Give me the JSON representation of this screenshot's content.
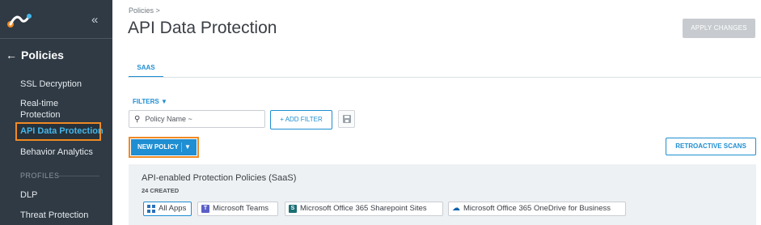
{
  "sidebar": {
    "collapse_glyph": "«",
    "back_label": "Policies",
    "items": [
      {
        "label": "SSL Decryption"
      },
      {
        "label": "Real-time\nProtection"
      },
      {
        "label": "API Data Protection"
      },
      {
        "label": "Behavior Analytics"
      }
    ],
    "section_label": "PROFILES",
    "section_items": [
      {
        "label": "DLP"
      },
      {
        "label": "Threat Protection"
      }
    ]
  },
  "header": {
    "breadcrumb": "Policies >",
    "title": "API Data Protection",
    "apply_label": "APPLY CHANGES"
  },
  "tabs": [
    {
      "label": "SAAS",
      "active": true
    }
  ],
  "filters": {
    "label": "FILTERS",
    "search_value": "Policy Name ~",
    "add_filter_label": "+ ADD FILTER"
  },
  "actions": {
    "new_policy_label": "NEW POLICY",
    "retroactive_label": "RETROACTIVE SCANS"
  },
  "policy_group": {
    "title": "API-enabled Protection Policies (SaaS)",
    "count": "24 CREATED",
    "apps": [
      {
        "label": "All Apps",
        "icon": "grid-icon",
        "selected": true
      },
      {
        "label": "Microsoft Teams",
        "icon": "teams-icon",
        "selected": false
      },
      {
        "label": "Microsoft Office 365 Sharepoint Sites",
        "icon": "sharepoint-icon",
        "selected": false
      },
      {
        "label": "Microsoft Office 365 OneDrive for Business",
        "icon": "onedrive-icon",
        "selected": false
      }
    ]
  },
  "colors": {
    "sidebar_bg": "#2f3a44",
    "accent": "#1f8ed2",
    "highlight_outline": "#f08a24"
  }
}
